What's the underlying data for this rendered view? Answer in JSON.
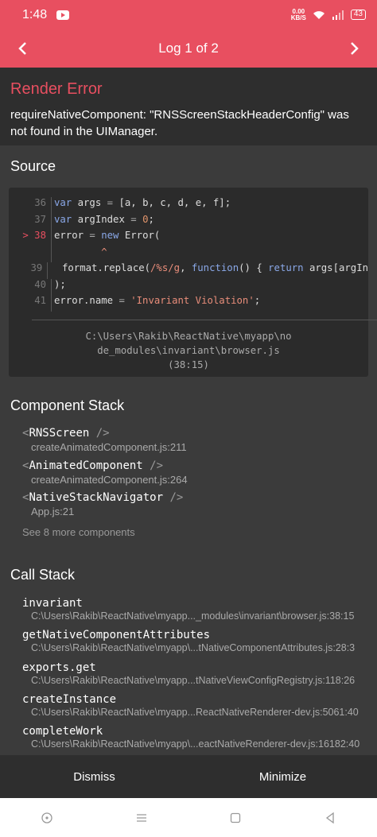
{
  "status_bar": {
    "time": "1:48",
    "net_speed": "0.00",
    "net_unit": "KB/S",
    "battery": "43"
  },
  "header": {
    "title": "Log 1 of 2"
  },
  "error": {
    "title": "Render Error",
    "message": "requireNativeComponent: \"RNSScreenStackHeaderConfig\" was not found in the UIManager."
  },
  "source": {
    "title": "Source",
    "lines": [
      {
        "num": "36",
        "active": false
      },
      {
        "num": "37",
        "active": false
      },
      {
        "num": "> 38",
        "active": true
      },
      {
        "num": "",
        "active": false
      },
      {
        "num": "39",
        "active": false
      },
      {
        "num": "40",
        "active": false
      },
      {
        "num": "41",
        "active": false
      }
    ],
    "file_line1": "C:\\Users\\Rakib\\ReactNative\\myapp\\no",
    "file_line2": "de_modules\\invariant\\browser.js",
    "file_pos": "(38:15)"
  },
  "component_stack": {
    "title": "Component Stack",
    "items": [
      {
        "name": "RNSScreen",
        "location": "createAnimatedComponent.js:211"
      },
      {
        "name": "AnimatedComponent",
        "location": "createAnimatedComponent.js:264"
      },
      {
        "name": "NativeStackNavigator",
        "location": "App.js:21"
      }
    ],
    "see_more": "See 8 more components"
  },
  "call_stack": {
    "title": "Call Stack",
    "items": [
      {
        "name": "invariant",
        "location": "C:\\Users\\Rakib\\ReactNative\\myapp..._modules\\invariant\\browser.js:38:15"
      },
      {
        "name": "getNativeComponentAttributes",
        "location": "C:\\Users\\Rakib\\ReactNative\\myapp\\...tNativeComponentAttributes.js:28:3"
      },
      {
        "name": "exports.get",
        "location": "C:\\Users\\Rakib\\ReactNative\\myapp...tNativeViewConfigRegistry.js:118:26"
      },
      {
        "name": "createInstance",
        "location": "C:\\Users\\Rakib\\ReactNative\\myapp...ReactNativeRenderer-dev.js:5061:40"
      },
      {
        "name": "completeWork",
        "location": "C:\\Users\\Rakib\\ReactNative\\myapp\\...eactNativeRenderer-dev.js:16182:40"
      }
    ]
  },
  "footer": {
    "dismiss": "Dismiss",
    "minimize": "Minimize"
  },
  "colors": {
    "accent": "#e84f60",
    "background": "#3b3b3b",
    "panel": "#2e2e2e"
  }
}
